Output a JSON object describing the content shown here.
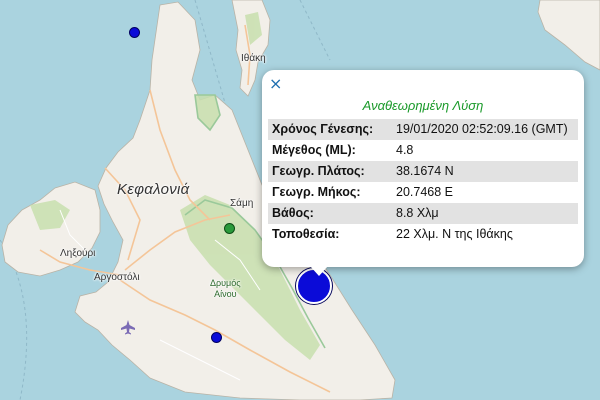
{
  "map": {
    "places": {
      "kefalonia": "Κεφαλονιά",
      "ithaki": "Ιθάκη",
      "sami": "Σάμη",
      "lixouri": "Ληξούρι",
      "argostoli": "Αργοστόλι",
      "drymos": "Δρυμός",
      "ainou": "Αίνου"
    },
    "colors": {
      "sea": "#aad3df",
      "land": "#f2efe9",
      "forest": "#c8dfae",
      "park_border": "#9ac99a",
      "road": "#f7c9a0",
      "quake_blue": "#0b0bd8",
      "quake_green": "#2a9a3a"
    },
    "icons": [
      "airport-icon",
      "close-icon"
    ]
  },
  "popup": {
    "close_symbol": "×",
    "title": "Αναθεωρημένη Λύση",
    "rows": [
      {
        "label": "Χρόνος Γένεσης:",
        "value": "19/01/2020 02:52:09.16 (GMT)"
      },
      {
        "label": "Μέγεθος (ML):",
        "value": "4.8"
      },
      {
        "label": "Γεωγρ. Πλάτος:",
        "value": "38.1674 N"
      },
      {
        "label": "Γεωγρ. Μήκος:",
        "value": "20.7468 E"
      },
      {
        "label": "Βάθος:",
        "value": "8.8 Χλμ"
      },
      {
        "label": "Τοποθεσία:",
        "value": "22 Χλμ. N της Ιθάκης"
      }
    ]
  }
}
